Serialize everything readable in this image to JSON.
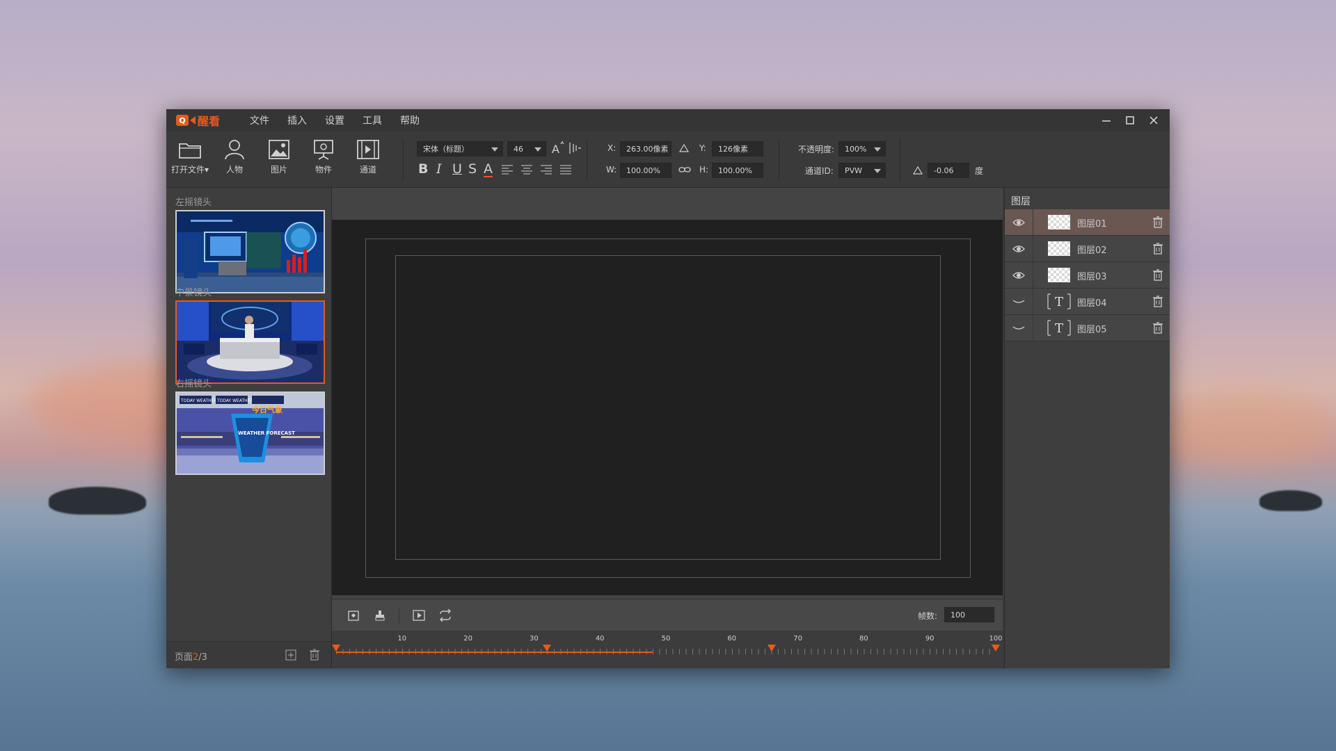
{
  "app": {
    "logo_letter": "Q",
    "logo_text": "醒看",
    "menu": [
      "文件",
      "插入",
      "设置",
      "工具",
      "帮助"
    ]
  },
  "toolbar": {
    "buttons": [
      "打开文件▾",
      "人物",
      "图片",
      "物件",
      "通道"
    ],
    "font_name": "宋体（标题）",
    "font_size": "46",
    "x_label": "X:",
    "x_value": "263.00像素",
    "y_label": "Y:",
    "y_value": "126像素",
    "w_label": "W:",
    "w_value": "100.00%",
    "h_label": "H:",
    "h_value": "100.00%",
    "opacity_label": "不透明度:",
    "opacity_value": "100%",
    "channel_label": "通道ID:",
    "channel_value": "PVW",
    "rotation_value": "-0.06",
    "rotation_unit": "度",
    "format_glyphs": [
      "B",
      "I",
      "U",
      "S",
      "A"
    ]
  },
  "scenes": {
    "items": [
      {
        "label": "左摇镜头",
        "selected": false
      },
      {
        "label": "中景镜头",
        "selected": true
      },
      {
        "label": "右摇镜头",
        "selected": false
      }
    ],
    "weather_text": "今日气象",
    "weather_sub": "WEATHER FORECAST",
    "today_weather": "TODAY WEATHER",
    "page_label": "页面",
    "page_current": "2",
    "page_total": "/3"
  },
  "controls": {
    "frames_label": "帧数:",
    "frames_value": "100"
  },
  "timeline": {
    "labels": [
      "10",
      "20",
      "30",
      "40",
      "50",
      "60",
      "70",
      "80",
      "90",
      "100"
    ],
    "keyframes": [
      0,
      32,
      66,
      100
    ],
    "progress": 48
  },
  "layers": {
    "title": "图层",
    "items": [
      {
        "name": "图层01",
        "type": "image",
        "visible": true,
        "selected": true
      },
      {
        "name": "图层02",
        "type": "image",
        "visible": true,
        "selected": false
      },
      {
        "name": "图层03",
        "type": "image",
        "visible": true,
        "selected": false
      },
      {
        "name": "图层04",
        "type": "text",
        "visible": false,
        "selected": false
      },
      {
        "name": "图层05",
        "type": "text",
        "visible": false,
        "selected": false
      }
    ]
  },
  "colors": {
    "accent": "#e85a1e",
    "selected_layer": "#6b5752"
  }
}
